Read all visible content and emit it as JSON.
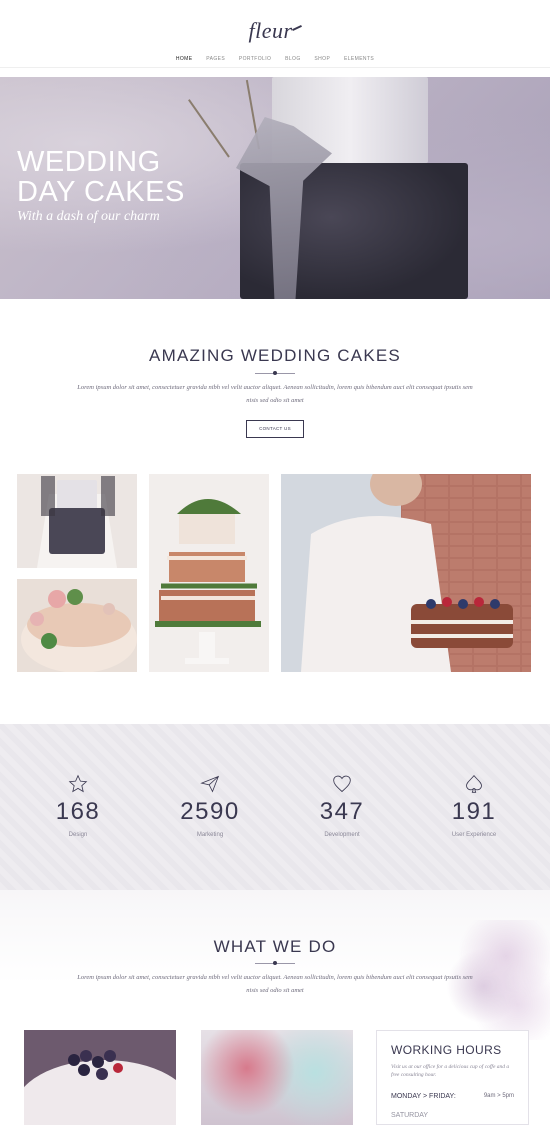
{
  "header": {
    "logo": "fleur",
    "nav": [
      "HOME",
      "PAGES",
      "PORTFOLIO",
      "BLOG",
      "SHOP",
      "ELEMENTS"
    ]
  },
  "hero": {
    "title_line1": "WEDDING",
    "title_line2": "DAY CAKES",
    "subtitle": "With a dash of our charm"
  },
  "intro": {
    "title": "AMAZING WEDDING CAKES",
    "text": "Lorem ipsum dolor sit amet, consectetuer gravida nibh vel velit auctor aliquet. Aenean sollicitudin, lorem quis bibendum auci elit consequat ipsutis sem nisis sed odio sit amet",
    "button": "CONTACT US"
  },
  "stats": [
    {
      "icon": "star-icon",
      "value": "168",
      "label": "Design"
    },
    {
      "icon": "paper-plane-icon",
      "value": "2590",
      "label": "Marketing"
    },
    {
      "icon": "heart-icon",
      "value": "347",
      "label": "Development"
    },
    {
      "icon": "spade-icon",
      "value": "191",
      "label": "User Experience"
    }
  ],
  "what_we_do": {
    "title": "WHAT WE DO",
    "text": "Lorem ipsum dolor sit amet, consectetuer gravida nibh vel velit auctor aliquet. Aenean sollicitudin, lorem quis bibendum auci elit consequat ipsutis sem nisis sed odio sit amet"
  },
  "working_hours": {
    "title": "WORKING HOURS",
    "text": "Visit us at our office for a delicious cup of coffe and a free consulting hour.",
    "row_label": "MONDAY > FRIDAY:",
    "row_time": "9am > 5pm",
    "next_row": "SATURDAY"
  },
  "colors": {
    "accent": "#3a3850",
    "muted": "#8a8797",
    "stats_bg": "#eeecf0"
  }
}
